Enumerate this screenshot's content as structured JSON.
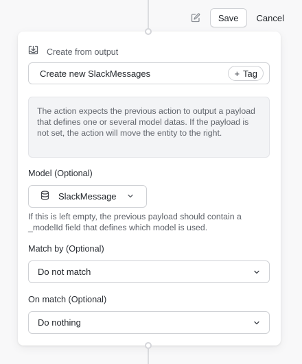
{
  "toolbar": {
    "save_label": "Save",
    "cancel_label": "Cancel",
    "edit_icon": "pencil-square-icon"
  },
  "header": {
    "title": "Create from output",
    "icon": "download-tray-icon"
  },
  "name_field": {
    "value": "Create new SlackMessages",
    "tag_label": "Tag"
  },
  "info_box": {
    "text": "The action expects the previous action to output a payload that defines one or several model datas. If the payload is not set, the action will move the entity to the right."
  },
  "model": {
    "label": "Model (Optional)",
    "value": "SlackMessage",
    "icon": "database-icon",
    "help": "If this is left empty, the previous payload should contain a _modelId field that defines which model is used."
  },
  "match_by": {
    "label": "Match by (Optional)",
    "value": "Do not match"
  },
  "on_match": {
    "label": "On match (Optional)",
    "value": "Do nothing"
  }
}
